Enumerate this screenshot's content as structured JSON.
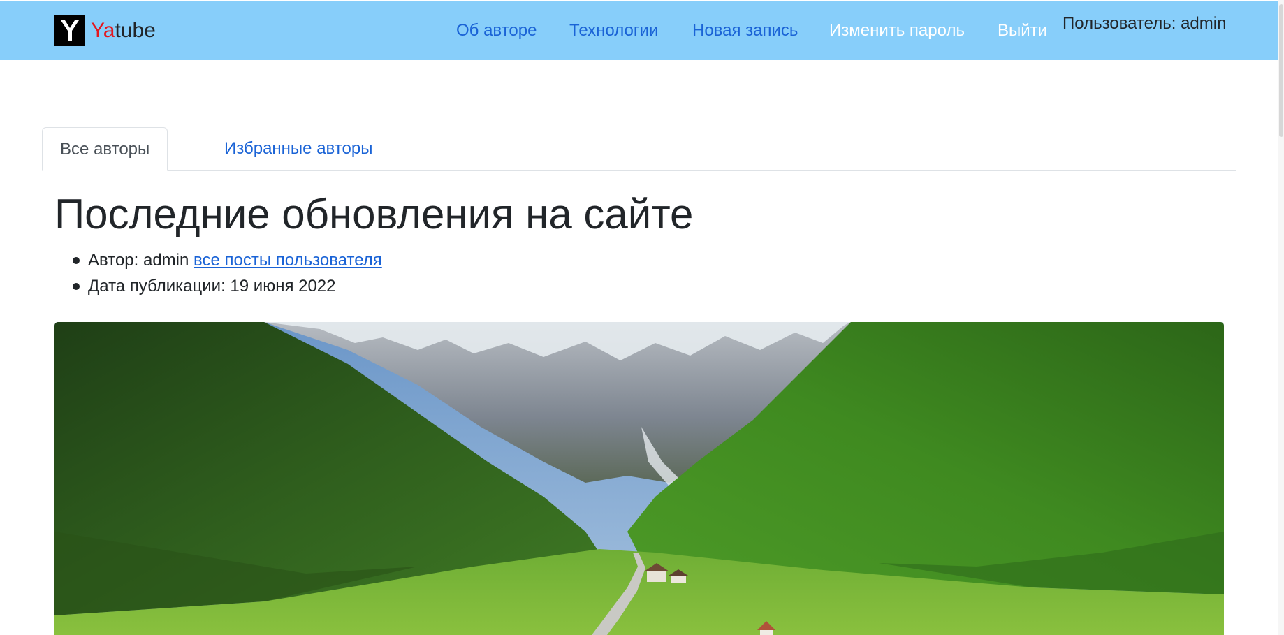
{
  "brand": {
    "logo_letter": "Y",
    "name_accent": "Ya",
    "name_rest": "tube"
  },
  "nav": {
    "items": [
      {
        "label": "Об авторе"
      },
      {
        "label": "Технологии"
      },
      {
        "label": "Новая запись"
      },
      {
        "label": "Изменить пароль"
      },
      {
        "label": "Выйти"
      }
    ],
    "user_label": "Пользователь: admin"
  },
  "tabs": [
    {
      "label": "Все авторы",
      "active": true
    },
    {
      "label": "Избранные авторы",
      "active": false
    }
  ],
  "main": {
    "title": "Последние обновления на сайте",
    "post": {
      "author_prefix": "Автор: admin",
      "author_link": "все посты пользователя",
      "date": "Дата публикации: 19 июня 2022",
      "image": "mountain-valley-photo"
    }
  },
  "colors": {
    "navbar": "#87cefa",
    "link": "#1a63d6",
    "brand_accent": "#e3171e"
  }
}
